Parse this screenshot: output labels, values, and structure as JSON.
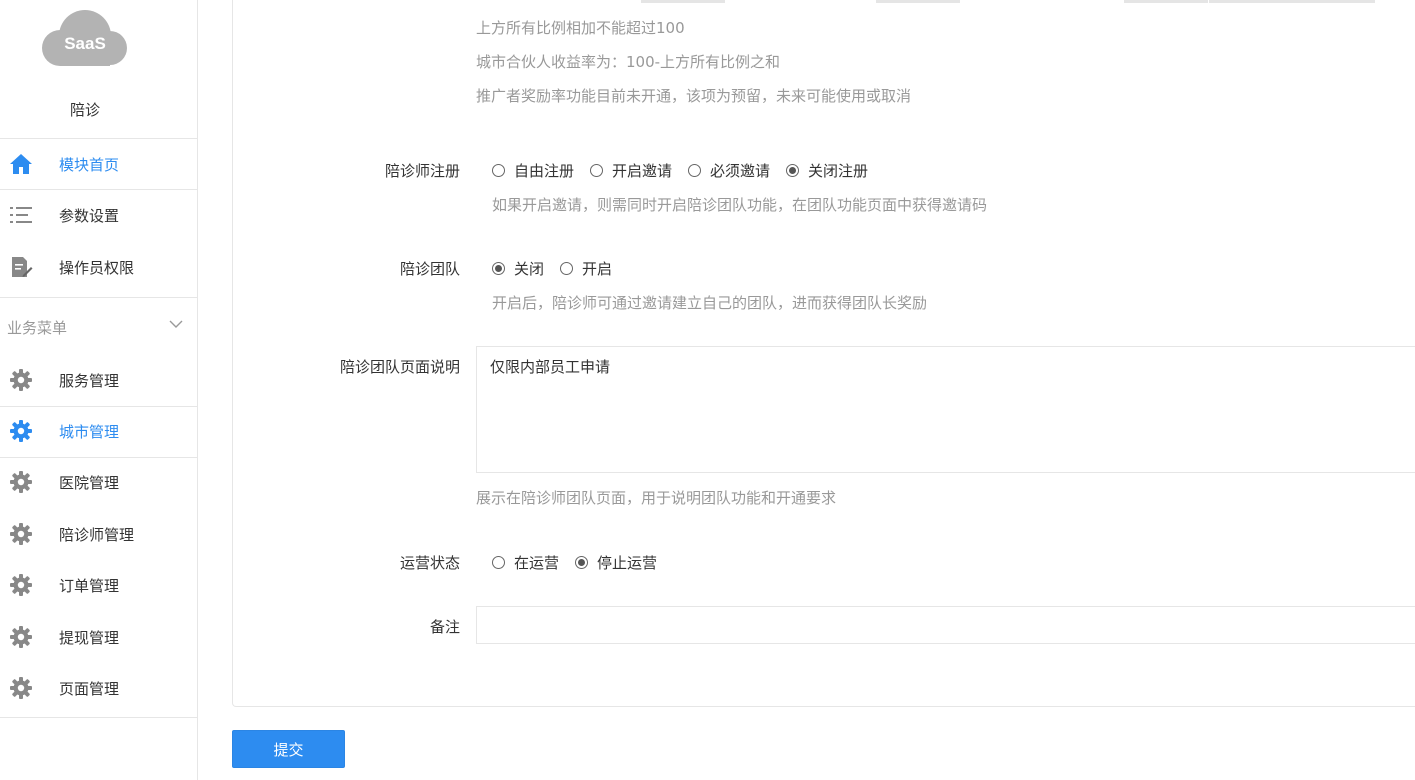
{
  "sidebar": {
    "logo_text": "SaaS",
    "app_name": "陪诊",
    "top_items": [
      {
        "label": "模块首页",
        "icon": "home-icon",
        "active": true
      },
      {
        "label": "参数设置",
        "icon": "list-icon",
        "active": false
      },
      {
        "label": "操作员权限",
        "icon": "document-edit-icon",
        "active": false
      }
    ],
    "section_title": "业务菜单",
    "section_icon": "chevron-down-icon",
    "business_items": [
      {
        "label": "服务管理",
        "icon": "gear-icon",
        "active": false
      },
      {
        "label": "城市管理",
        "icon": "gear-icon",
        "active": true
      },
      {
        "label": "医院管理",
        "icon": "gear-icon",
        "active": false
      },
      {
        "label": "陪诊师管理",
        "icon": "gear-icon",
        "active": false
      },
      {
        "label": "订单管理",
        "icon": "gear-icon",
        "active": false
      },
      {
        "label": "提现管理",
        "icon": "gear-icon",
        "active": false
      },
      {
        "label": "页面管理",
        "icon": "gear-icon",
        "active": false
      }
    ]
  },
  "colors": {
    "accent": "#2d8cf0",
    "logo_cloud": "#b3b3b3",
    "icon_gray": "#888888"
  },
  "form": {
    "ratio_hints": [
      "上方所有比例相加不能超过100",
      "城市合伙人收益率为：100-上方所有比例之和",
      "推广者奖励率功能目前未开通，该项为预留，未来可能使用或取消"
    ],
    "register": {
      "label": "陪诊师注册",
      "options": [
        "自由注册",
        "开启邀请",
        "必须邀请",
        "关闭注册"
      ],
      "selected": "关闭注册",
      "hint": "如果开启邀请，则需同时开启陪诊团队功能，在团队功能页面中获得邀请码"
    },
    "team": {
      "label": "陪诊团队",
      "options": [
        "关闭",
        "开启"
      ],
      "selected": "关闭",
      "hint": "开启后，陪诊师可通过邀请建立自己的团队，进而获得团队长奖励"
    },
    "team_desc": {
      "label": "陪诊团队页面说明",
      "value": "仅限内部员工申请",
      "hint": "展示在陪诊师团队页面，用于说明团队功能和开通要求"
    },
    "status": {
      "label": "运营状态",
      "options": [
        "在运营",
        "停止运营"
      ],
      "selected": "停止运营"
    },
    "remark": {
      "label": "备注",
      "value": ""
    }
  },
  "submit_label": "提交"
}
